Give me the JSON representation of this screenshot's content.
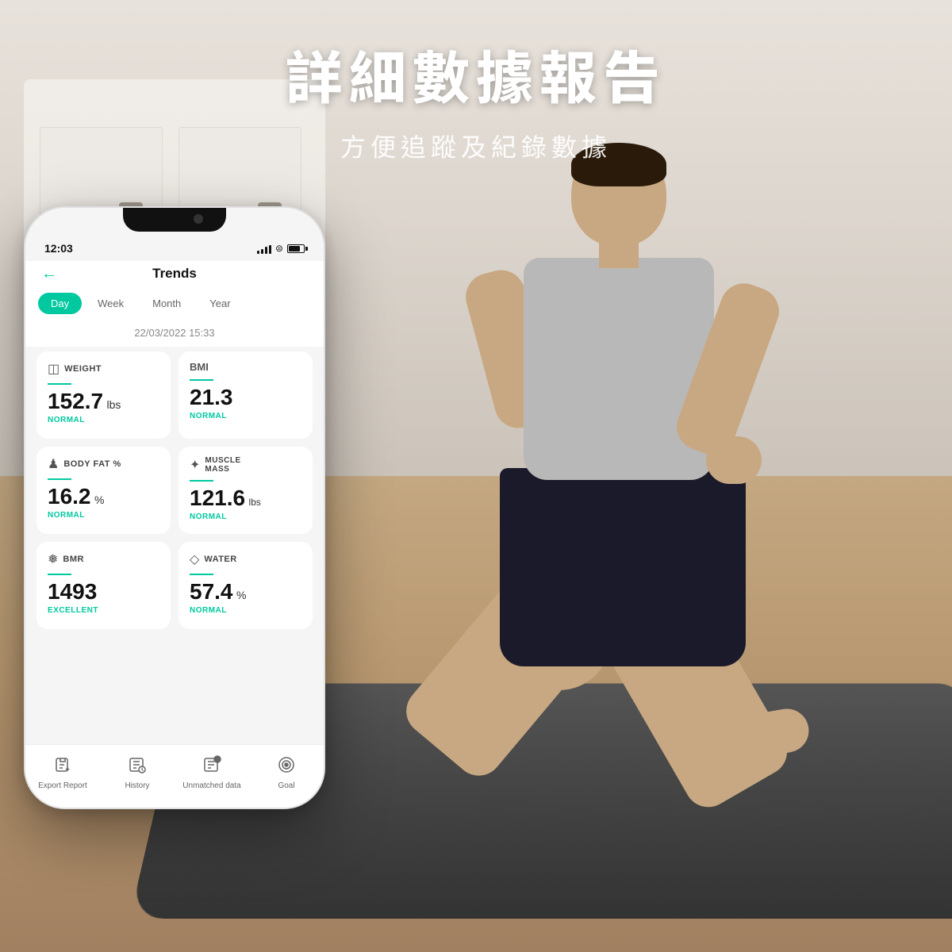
{
  "page": {
    "title": "詳細數據報告",
    "subtitle": "方便追蹤及紀錄數據"
  },
  "phone": {
    "status": {
      "time": "12:03",
      "signal": [
        3,
        5,
        7,
        9,
        11
      ],
      "battery": "80"
    },
    "app": {
      "title": "Trends",
      "back_label": "←",
      "tabs": [
        "Day",
        "Week",
        "Month",
        "Year"
      ],
      "active_tab": "Day",
      "date": "22/03/2022 15:33",
      "metrics": [
        {
          "label": "WEIGHT",
          "icon": "⊞",
          "value": "152.7",
          "unit": "lbs",
          "status": "NORMAL",
          "status_type": "normal"
        },
        {
          "label": "BMI",
          "icon": "◎",
          "value": "21.3",
          "unit": "",
          "status": "NORMAL",
          "status_type": "normal"
        },
        {
          "label": "BODY FAT %",
          "icon": "♟",
          "value": "16.2",
          "unit": "%",
          "status": "NORMAL",
          "status_type": "normal"
        },
        {
          "label": "MUSCLE MASS",
          "icon": "✦",
          "value": "121.6",
          "unit": "lbs",
          "status": "NORMAL",
          "status_type": "normal"
        },
        {
          "label": "BMR",
          "icon": "❄",
          "value": "1493",
          "unit": "",
          "status": "EXCELLENT",
          "status_type": "excellent"
        },
        {
          "label": "WATER",
          "icon": "◇",
          "value": "57.4",
          "unit": "%",
          "status": "NORMAL",
          "status_type": "normal"
        }
      ],
      "nav": [
        {
          "label": "Export Report",
          "icon": "⬆"
        },
        {
          "label": "History",
          "icon": "🕐"
        },
        {
          "label": "Unmatched data",
          "icon": "?"
        },
        {
          "label": "Goal",
          "icon": "◎"
        }
      ]
    }
  }
}
